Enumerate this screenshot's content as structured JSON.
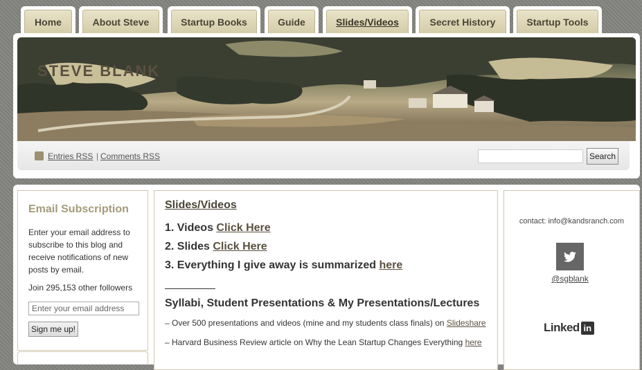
{
  "nav": {
    "tabs": [
      {
        "label": "Home"
      },
      {
        "label": "About Steve"
      },
      {
        "label": "Startup Books"
      },
      {
        "label": "Guide"
      },
      {
        "label": "Slides/Videos"
      },
      {
        "label": "Secret History"
      },
      {
        "label": "Startup Tools"
      }
    ],
    "active_label": "Slides/Videos"
  },
  "header": {
    "site_title": "STEVE BLANK",
    "entries_rss": "Entries RSS",
    "separator": "|",
    "comments_rss": "Comments RSS",
    "search_placeholder": "",
    "search_button": "Search"
  },
  "sidebar": {
    "title": "Email Subscription",
    "description": "Enter your email address to subscribe to this blog and receive notifications of new posts by email.",
    "followers": "Join 295,153 other followers",
    "email_placeholder": "Enter your email address",
    "signup_button": "Sign me up!"
  },
  "main": {
    "title": "Slides/Videos",
    "items": [
      {
        "text": "1. Videos ",
        "link": "Click Here"
      },
      {
        "text": "2. Slides ",
        "link": "Click Here"
      },
      {
        "text": "3. Everything I give away is summarized ",
        "link": "here"
      }
    ],
    "section_title": "Syllabi, Student Presentations & My Presentations/Lectures",
    "lines": [
      {
        "text": "– Over 500 presentations and videos (mine and my students class finals) on ",
        "link": "Slideshare"
      },
      {
        "text": "– Harvard Business Review article on Why the Lean Startup Changes Everything ",
        "link": "here"
      }
    ]
  },
  "right": {
    "contact": "contact: info@kandsranch.com",
    "twitter_icon": "twitter-bird-icon",
    "twitter_handle": "@sgblank",
    "linkedin_text": "Linked",
    "linkedin_badge": "in"
  },
  "colors": {
    "tab_bg": "#d4cca8",
    "accent_text": "#a49a7a",
    "link": "#5a5040"
  }
}
